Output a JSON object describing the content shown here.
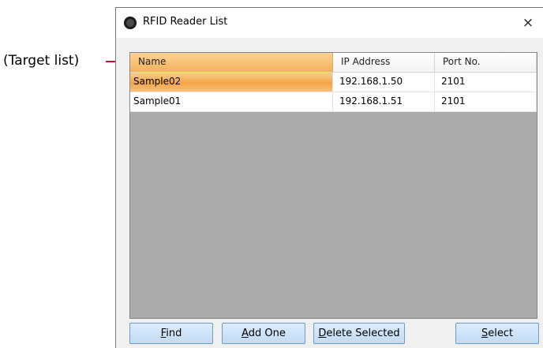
{
  "annotation": {
    "label": "(Target list)"
  },
  "window": {
    "title": "RFID Reader List",
    "close_symbol": "×"
  },
  "list": {
    "columns": [
      "Name",
      "IP Address",
      "Port No."
    ],
    "sorted_column": "Name",
    "rows": [
      {
        "name": "Sample02",
        "ip": "192.168.1.50",
        "port": "2101",
        "selected": true
      },
      {
        "name": "Sample01",
        "ip": "192.168.1.51",
        "port": "2101",
        "selected": false
      }
    ]
  },
  "buttons": {
    "find": {
      "mnemonic": "F",
      "rest": "ind"
    },
    "add_one": {
      "mnemonic": "A",
      "rest": "dd One"
    },
    "delete_selected": {
      "mnemonic": "D",
      "rest": "elete Selected"
    },
    "select": {
      "mnemonic": "S",
      "rest": "elect"
    }
  },
  "colors": {
    "callout_line": "#c8102e",
    "selection_orange": "#f4a447",
    "button_blue": "#c1dbf5",
    "list_background": "#ababab"
  }
}
